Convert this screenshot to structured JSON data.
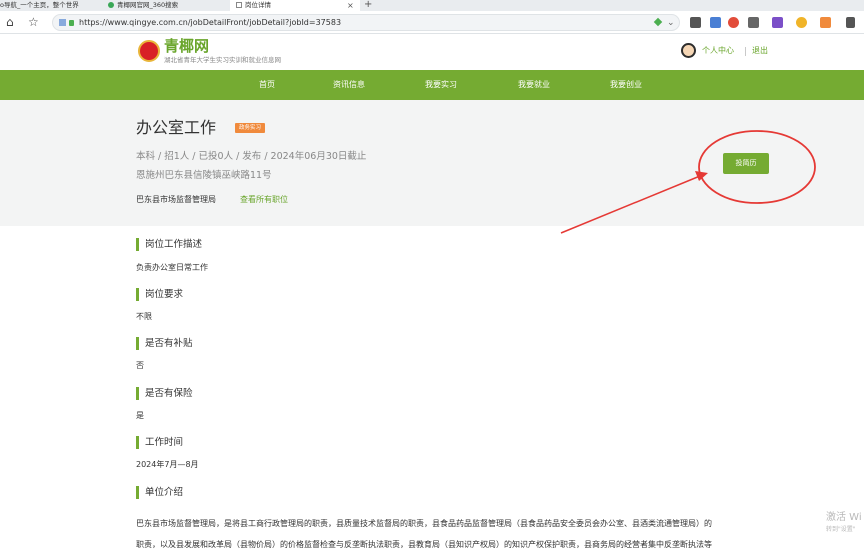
{
  "browser": {
    "tabs": [
      {
        "label": "o导航_一个主页，整个世界",
        "active": false
      },
      {
        "label": "青椰网官网_360搜索",
        "active": false
      },
      {
        "label": "岗位详情",
        "active": true
      }
    ],
    "close_glyph": "×",
    "new_tab_glyph": "+",
    "url": "https://www.qingye.com.cn/jobDetailFront/jobDetail?jobId=37583",
    "icons": [
      "home-icon",
      "star-icon",
      "lock-icon",
      "dropdown-icon",
      "extension-icons"
    ]
  },
  "site": {
    "logo_title": "青椰网",
    "logo_subtitle": "湖北省青年大学生实习实训和就业信息网",
    "user_center": "个人中心",
    "logout": "退出",
    "nav": [
      "首页",
      "资讯信息",
      "我要实习",
      "我要就业",
      "我要创业"
    ],
    "accent_color": "#75ab32"
  },
  "job": {
    "title": "办公室工作",
    "tag": "政务实习",
    "meta": "本科 / 招1人 / 已投0人 / 发布 / 2024年06月30日截止",
    "address": "恩施州巴东县信陵镇巫峡路11号",
    "company": "巴东县市场监督管理局",
    "all_positions_link": "查看所有职位",
    "apply_button": "投简历"
  },
  "sections": [
    {
      "heading": "岗位工作描述",
      "body": "负责办公室日常工作"
    },
    {
      "heading": "岗位要求",
      "body": "不限"
    },
    {
      "heading": "是否有补贴",
      "body": "否"
    },
    {
      "heading": "是否有保险",
      "body": "是"
    },
    {
      "heading": "工作时间",
      "body": "2024年7月—8月"
    },
    {
      "heading": "单位介绍",
      "body": ""
    }
  ],
  "intro_lines": [
    "巴东县市场监督管理局，是将县工商行政管理局的职责，县质量技术监督局的职责，县食品药品监督管理局（县食品药品安全委员会办公室、县酒类流通管理局）的",
    "职责，以及县发展和改革局（县物价局）的价格监督检查与反垄断执法职责，县教育局（县知识产权局）的知识产权保护职责，县商务局的经营者集中反垄断执法等"
  ],
  "watermark": {
    "line1": "激活 Wi",
    "line2": "转到\"设置\""
  }
}
